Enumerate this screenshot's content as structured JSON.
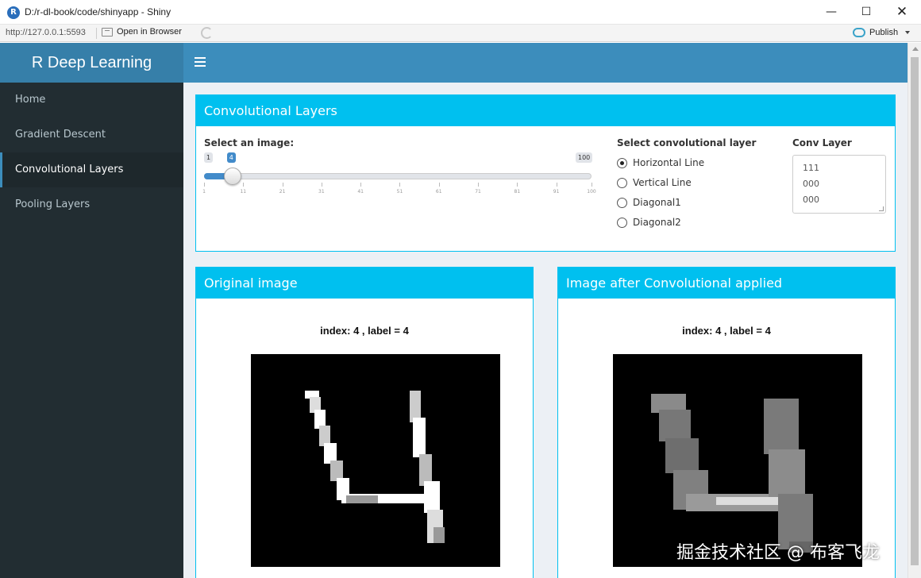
{
  "window": {
    "title": "D:/r-dl-book/code/shinyapp - Shiny",
    "url": "http://127.0.0.1:5593",
    "open_browser_label": "Open in Browser",
    "publish_label": "Publish"
  },
  "header": {
    "app_title": "R Deep Learning"
  },
  "sidebar": {
    "items": [
      {
        "label": "Home"
      },
      {
        "label": "Gradient Descent"
      },
      {
        "label": "Convolutional Layers",
        "active": true
      },
      {
        "label": "Pooling Layers"
      }
    ]
  },
  "main_box": {
    "title": "Convolutional Layers",
    "image_select": {
      "label": "Select an image:",
      "min": "1",
      "max": "100",
      "value": "4",
      "value_fraction": 0.0303,
      "ticks": [
        "1",
        "11",
        "21",
        "31",
        "41",
        "51",
        "61",
        "71",
        "81",
        "91",
        "100"
      ]
    },
    "conv_select": {
      "label": "Select convolutional layer",
      "options": [
        "Horizontal Line",
        "Vertical Line",
        "Diagonal1",
        "Diagonal2"
      ],
      "selected": "Horizontal Line"
    },
    "conv_layer": {
      "label": "Conv Layer",
      "lines": [
        "111",
        "000",
        "000"
      ]
    }
  },
  "original_box": {
    "title": "Original image",
    "plot_title": "index: 4 , label = 4"
  },
  "conv_box": {
    "title": "Image after Convolutional applied",
    "plot_title": "index: 4 , label = 4"
  },
  "watermark": "掘金技术社区 @ 布客飞龙",
  "colors": {
    "logo_bg": "#367fa9",
    "navbar_bg": "#3c8dbc",
    "sidebar_bg": "#222d32",
    "box_header": "#00c0ef",
    "content_bg": "#ecf0f5"
  }
}
